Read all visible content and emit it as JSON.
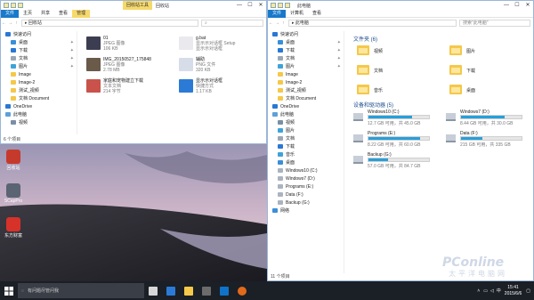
{
  "left_window": {
    "title": "回收站",
    "tool_context_tab": "回收站工具",
    "ribbon": [
      "文件",
      "主页",
      "共享",
      "查看",
      "管理"
    ],
    "address": "回收站",
    "nav": [
      {
        "label": "快速访问",
        "icon": "star-icon",
        "pinned": false
      },
      {
        "label": "桌面",
        "icon": "desktop-icon",
        "pinned": true
      },
      {
        "label": "下载",
        "icon": "download-icon",
        "pinned": true
      },
      {
        "label": "文档",
        "icon": "document-icon",
        "pinned": true
      },
      {
        "label": "图片",
        "icon": "picture-icon",
        "pinned": true
      },
      {
        "label": "Image",
        "icon": "folder-icon",
        "pinned": false
      },
      {
        "label": "Image-2",
        "icon": "folder-icon",
        "pinned": false
      },
      {
        "label": "测试_视频",
        "icon": "folder-icon",
        "pinned": false
      },
      {
        "label": "文档 Document",
        "icon": "folder-icon",
        "pinned": false
      },
      {
        "label": "OneDrive",
        "icon": "cloud-icon",
        "pinned": false
      },
      {
        "label": "此电脑",
        "icon": "computer-icon",
        "pinned": false
      },
      {
        "label": "视频",
        "icon": "video-icon",
        "pinned": false
      }
    ],
    "items": [
      {
        "name": "01",
        "line2": "JPEG 图像",
        "line3": "106 KB",
        "thumb": "#3d3d52"
      },
      {
        "name": "g.bat",
        "line2": "显示示对话框 Setup",
        "line3": "显示示对话框",
        "thumb": "#e9e9ee"
      },
      {
        "name": "IMG_20150527_175848",
        "line2": "JPEG 图像",
        "line3": "2.78 MB",
        "thumb": "#6a5a4a"
      },
      {
        "name": "辅助",
        "line2": "PNG 文件",
        "line3": "320 KB",
        "thumb": "#d7dde8"
      },
      {
        "name": "家庭和宠物建立下载",
        "line2": "文本文档",
        "line3": "214 字节",
        "thumb": "#c9534a"
      },
      {
        "name": "显示示对话框",
        "line2": "快捷方式",
        "line3": "1.17 KB",
        "thumb": "#2b7bd6"
      }
    ],
    "status": "6 个项目"
  },
  "right_window": {
    "title": "此电脑",
    "ribbon": [
      "文件",
      "计算机",
      "查看"
    ],
    "address": "此电脑",
    "search_placeholder": "搜索\"此电脑\"",
    "nav": [
      {
        "label": "快速访问",
        "icon": "star-icon",
        "pinned": false
      },
      {
        "label": "桌面",
        "icon": "desktop-icon",
        "pinned": true
      },
      {
        "label": "下载",
        "icon": "download-icon",
        "pinned": true
      },
      {
        "label": "文档",
        "icon": "document-icon",
        "pinned": true
      },
      {
        "label": "图片",
        "icon": "picture-icon",
        "pinned": true
      },
      {
        "label": "Image",
        "icon": "folder-icon",
        "pinned": false
      },
      {
        "label": "Image-2",
        "icon": "folder-icon",
        "pinned": false
      },
      {
        "label": "测试_视频",
        "icon": "folder-icon",
        "pinned": false
      },
      {
        "label": "文档 Document",
        "icon": "folder-icon",
        "pinned": false
      },
      {
        "label": "OneDrive",
        "icon": "cloud-icon",
        "pinned": false
      },
      {
        "label": "此电脑",
        "icon": "computer-icon",
        "pinned": false
      },
      {
        "label": "视频",
        "icon": "video-icon",
        "pinned": false
      },
      {
        "label": "图片",
        "icon": "picture-icon",
        "pinned": false
      },
      {
        "label": "文档",
        "icon": "document-icon",
        "pinned": false
      },
      {
        "label": "下载",
        "icon": "download-icon",
        "pinned": false
      },
      {
        "label": "音乐",
        "icon": "music-icon",
        "pinned": false
      },
      {
        "label": "桌面",
        "icon": "desktop-icon",
        "pinned": false
      },
      {
        "label": "Windows10 (C:)",
        "icon": "drive-icon",
        "pinned": false
      },
      {
        "label": "Windows7 (D:)",
        "icon": "drive-icon",
        "pinned": false
      },
      {
        "label": "Programs (E:)",
        "icon": "drive-icon",
        "pinned": false
      },
      {
        "label": "Data (F:)",
        "icon": "drive-icon",
        "pinned": false
      },
      {
        "label": "Backup (G:)",
        "icon": "drive-icon",
        "pinned": false
      },
      {
        "label": "网络",
        "icon": "network-icon",
        "pinned": false
      }
    ],
    "folders_header": "文件夹 (6)",
    "folders": [
      "视频",
      "图片",
      "文档",
      "下载",
      "音乐",
      "桌面"
    ],
    "drives_header": "设备和驱动器 (5)",
    "drives": [
      {
        "name": "Windows10 (C:)",
        "free": "12.7 GB 可用，共 45.0 GB",
        "used": 0.72
      },
      {
        "name": "Windows7 (D:)",
        "free": "8.44 GB 可用，共 30.0 GB",
        "used": 0.72
      },
      {
        "name": "Programs (E:)",
        "free": "8.22 GB 可用，共 60.0 GB",
        "used": 0.86
      },
      {
        "name": "Data (F:)",
        "free": "215 GB 可用，共 335 GB",
        "used": 0.36
      },
      {
        "name": "Backup (G:)",
        "free": "57.0 GB 可用，共 84.7 GB",
        "used": 0.33
      }
    ],
    "status": "11 个项目"
  },
  "desktop_icons": [
    {
      "label": "回收站",
      "color": "#c63a2c"
    },
    {
      "label": "SCapPro",
      "color": "#5a6472"
    },
    {
      "label": "东方财富",
      "color": "#d6322a"
    }
  ],
  "taskbar": {
    "search_placeholder": "有问题尽管问我",
    "time": "15:41",
    "date": "2015/6/6",
    "lang": "中",
    "apps": [
      {
        "name": "task-view-icon",
        "color": "#d7d7d7"
      },
      {
        "name": "edge-icon",
        "color": "#2b7bd6"
      },
      {
        "name": "explorer-icon",
        "color": "#f5c84a"
      },
      {
        "name": "store-icon",
        "color": "#6c6c6c"
      },
      {
        "name": "outlook-icon",
        "color": "#0f73c9"
      },
      {
        "name": "app-icon",
        "color": "#e26a1a"
      }
    ]
  },
  "watermark": {
    "brand": "PConline",
    "sub": "太平洋电脑网"
  }
}
